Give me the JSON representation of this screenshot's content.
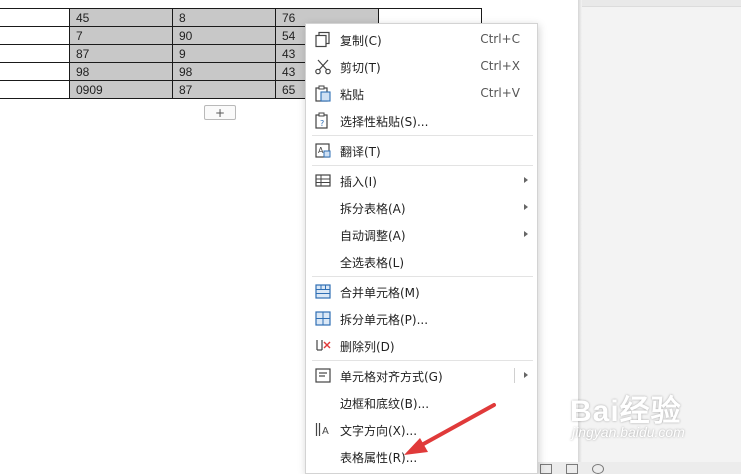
{
  "table": {
    "rows": [
      [
        "",
        "45",
        "8",
        "76",
        ""
      ],
      [
        "",
        "7",
        "90",
        "54",
        ""
      ],
      [
        "",
        "87",
        "9",
        "43",
        ""
      ],
      [
        "",
        "98",
        "98",
        "43",
        ""
      ],
      [
        "",
        "0909",
        "87",
        "65",
        ""
      ]
    ],
    "add_row_label": "+"
  },
  "context_menu": {
    "items": [
      {
        "id": "copy",
        "label": "复制(C)",
        "shortcut": "Ctrl+C",
        "icon": "copy-icon"
      },
      {
        "id": "cut",
        "label": "剪切(T)",
        "shortcut": "Ctrl+X",
        "icon": "scissors-icon"
      },
      {
        "id": "paste",
        "label": "粘贴",
        "shortcut": "Ctrl+V",
        "icon": "paste-icon"
      },
      {
        "id": "paste-special",
        "label": "选择性粘贴(S)...",
        "icon": "paste-special-icon"
      },
      {
        "id": "translate",
        "label": "翻译(T)",
        "icon": "translate-icon"
      },
      {
        "id": "insert",
        "label": "插入(I)",
        "icon": "table-insert-icon",
        "submenu": true
      },
      {
        "id": "split-table",
        "label": "拆分表格(A)",
        "submenu": true
      },
      {
        "id": "autofit",
        "label": "自动调整(A)",
        "submenu": true
      },
      {
        "id": "select-table",
        "label": "全选表格(L)"
      },
      {
        "id": "merge-cells",
        "label": "合并单元格(M)",
        "icon": "merge-cells-icon"
      },
      {
        "id": "split-cells",
        "label": "拆分单元格(P)...",
        "icon": "split-cells-icon"
      },
      {
        "id": "delete-column",
        "label": "删除列(D)",
        "icon": "delete-column-icon"
      },
      {
        "id": "cell-alignment",
        "label": "单元格对齐方式(G)",
        "icon": "cell-align-icon",
        "submenu": true
      },
      {
        "id": "borders",
        "label": "边框和底纹(B)..."
      },
      {
        "id": "text-direction",
        "label": "文字方向(X)...",
        "icon": "text-direction-icon"
      },
      {
        "id": "table-properties",
        "label": "表格属性(R)..."
      }
    ]
  },
  "watermark": {
    "brand": "Bai经验",
    "url": "jingyan.baidu.com"
  },
  "colors": {
    "selected_cell": "#c8c8c8",
    "annotation_arrow": "#e03a3a",
    "icon_blue": "#2f6fb5"
  }
}
